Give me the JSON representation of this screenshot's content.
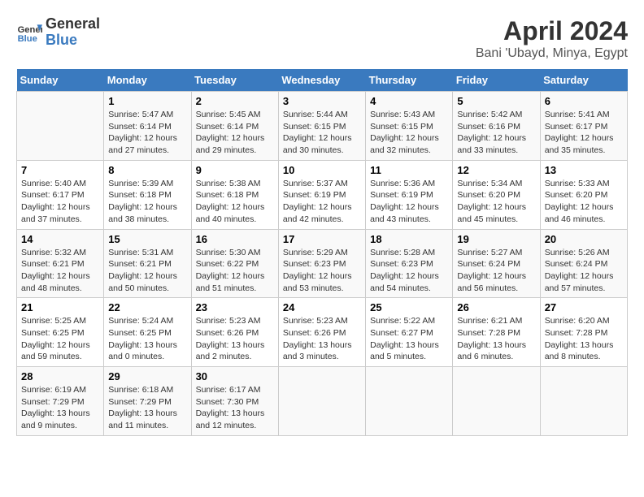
{
  "header": {
    "logo_line1": "General",
    "logo_line2": "Blue",
    "title": "April 2024",
    "subtitle": "Bani 'Ubayd, Minya, Egypt"
  },
  "days_of_week": [
    "Sunday",
    "Monday",
    "Tuesday",
    "Wednesday",
    "Thursday",
    "Friday",
    "Saturday"
  ],
  "weeks": [
    [
      {
        "day": "",
        "info": ""
      },
      {
        "day": "1",
        "info": "Sunrise: 5:47 AM\nSunset: 6:14 PM\nDaylight: 12 hours\nand 27 minutes."
      },
      {
        "day": "2",
        "info": "Sunrise: 5:45 AM\nSunset: 6:14 PM\nDaylight: 12 hours\nand 29 minutes."
      },
      {
        "day": "3",
        "info": "Sunrise: 5:44 AM\nSunset: 6:15 PM\nDaylight: 12 hours\nand 30 minutes."
      },
      {
        "day": "4",
        "info": "Sunrise: 5:43 AM\nSunset: 6:15 PM\nDaylight: 12 hours\nand 32 minutes."
      },
      {
        "day": "5",
        "info": "Sunrise: 5:42 AM\nSunset: 6:16 PM\nDaylight: 12 hours\nand 33 minutes."
      },
      {
        "day": "6",
        "info": "Sunrise: 5:41 AM\nSunset: 6:17 PM\nDaylight: 12 hours\nand 35 minutes."
      }
    ],
    [
      {
        "day": "7",
        "info": "Sunrise: 5:40 AM\nSunset: 6:17 PM\nDaylight: 12 hours\nand 37 minutes."
      },
      {
        "day": "8",
        "info": "Sunrise: 5:39 AM\nSunset: 6:18 PM\nDaylight: 12 hours\nand 38 minutes."
      },
      {
        "day": "9",
        "info": "Sunrise: 5:38 AM\nSunset: 6:18 PM\nDaylight: 12 hours\nand 40 minutes."
      },
      {
        "day": "10",
        "info": "Sunrise: 5:37 AM\nSunset: 6:19 PM\nDaylight: 12 hours\nand 42 minutes."
      },
      {
        "day": "11",
        "info": "Sunrise: 5:36 AM\nSunset: 6:19 PM\nDaylight: 12 hours\nand 43 minutes."
      },
      {
        "day": "12",
        "info": "Sunrise: 5:34 AM\nSunset: 6:20 PM\nDaylight: 12 hours\nand 45 minutes."
      },
      {
        "day": "13",
        "info": "Sunrise: 5:33 AM\nSunset: 6:20 PM\nDaylight: 12 hours\nand 46 minutes."
      }
    ],
    [
      {
        "day": "14",
        "info": "Sunrise: 5:32 AM\nSunset: 6:21 PM\nDaylight: 12 hours\nand 48 minutes."
      },
      {
        "day": "15",
        "info": "Sunrise: 5:31 AM\nSunset: 6:21 PM\nDaylight: 12 hours\nand 50 minutes."
      },
      {
        "day": "16",
        "info": "Sunrise: 5:30 AM\nSunset: 6:22 PM\nDaylight: 12 hours\nand 51 minutes."
      },
      {
        "day": "17",
        "info": "Sunrise: 5:29 AM\nSunset: 6:23 PM\nDaylight: 12 hours\nand 53 minutes."
      },
      {
        "day": "18",
        "info": "Sunrise: 5:28 AM\nSunset: 6:23 PM\nDaylight: 12 hours\nand 54 minutes."
      },
      {
        "day": "19",
        "info": "Sunrise: 5:27 AM\nSunset: 6:24 PM\nDaylight: 12 hours\nand 56 minutes."
      },
      {
        "day": "20",
        "info": "Sunrise: 5:26 AM\nSunset: 6:24 PM\nDaylight: 12 hours\nand 57 minutes."
      }
    ],
    [
      {
        "day": "21",
        "info": "Sunrise: 5:25 AM\nSunset: 6:25 PM\nDaylight: 12 hours\nand 59 minutes."
      },
      {
        "day": "22",
        "info": "Sunrise: 5:24 AM\nSunset: 6:25 PM\nDaylight: 13 hours\nand 0 minutes."
      },
      {
        "day": "23",
        "info": "Sunrise: 5:23 AM\nSunset: 6:26 PM\nDaylight: 13 hours\nand 2 minutes."
      },
      {
        "day": "24",
        "info": "Sunrise: 5:23 AM\nSunset: 6:26 PM\nDaylight: 13 hours\nand 3 minutes."
      },
      {
        "day": "25",
        "info": "Sunrise: 5:22 AM\nSunset: 6:27 PM\nDaylight: 13 hours\nand 5 minutes."
      },
      {
        "day": "26",
        "info": "Sunrise: 6:21 AM\nSunset: 7:28 PM\nDaylight: 13 hours\nand 6 minutes."
      },
      {
        "day": "27",
        "info": "Sunrise: 6:20 AM\nSunset: 7:28 PM\nDaylight: 13 hours\nand 8 minutes."
      }
    ],
    [
      {
        "day": "28",
        "info": "Sunrise: 6:19 AM\nSunset: 7:29 PM\nDaylight: 13 hours\nand 9 minutes."
      },
      {
        "day": "29",
        "info": "Sunrise: 6:18 AM\nSunset: 7:29 PM\nDaylight: 13 hours\nand 11 minutes."
      },
      {
        "day": "30",
        "info": "Sunrise: 6:17 AM\nSunset: 7:30 PM\nDaylight: 13 hours\nand 12 minutes."
      },
      {
        "day": "",
        "info": ""
      },
      {
        "day": "",
        "info": ""
      },
      {
        "day": "",
        "info": ""
      },
      {
        "day": "",
        "info": ""
      }
    ]
  ]
}
